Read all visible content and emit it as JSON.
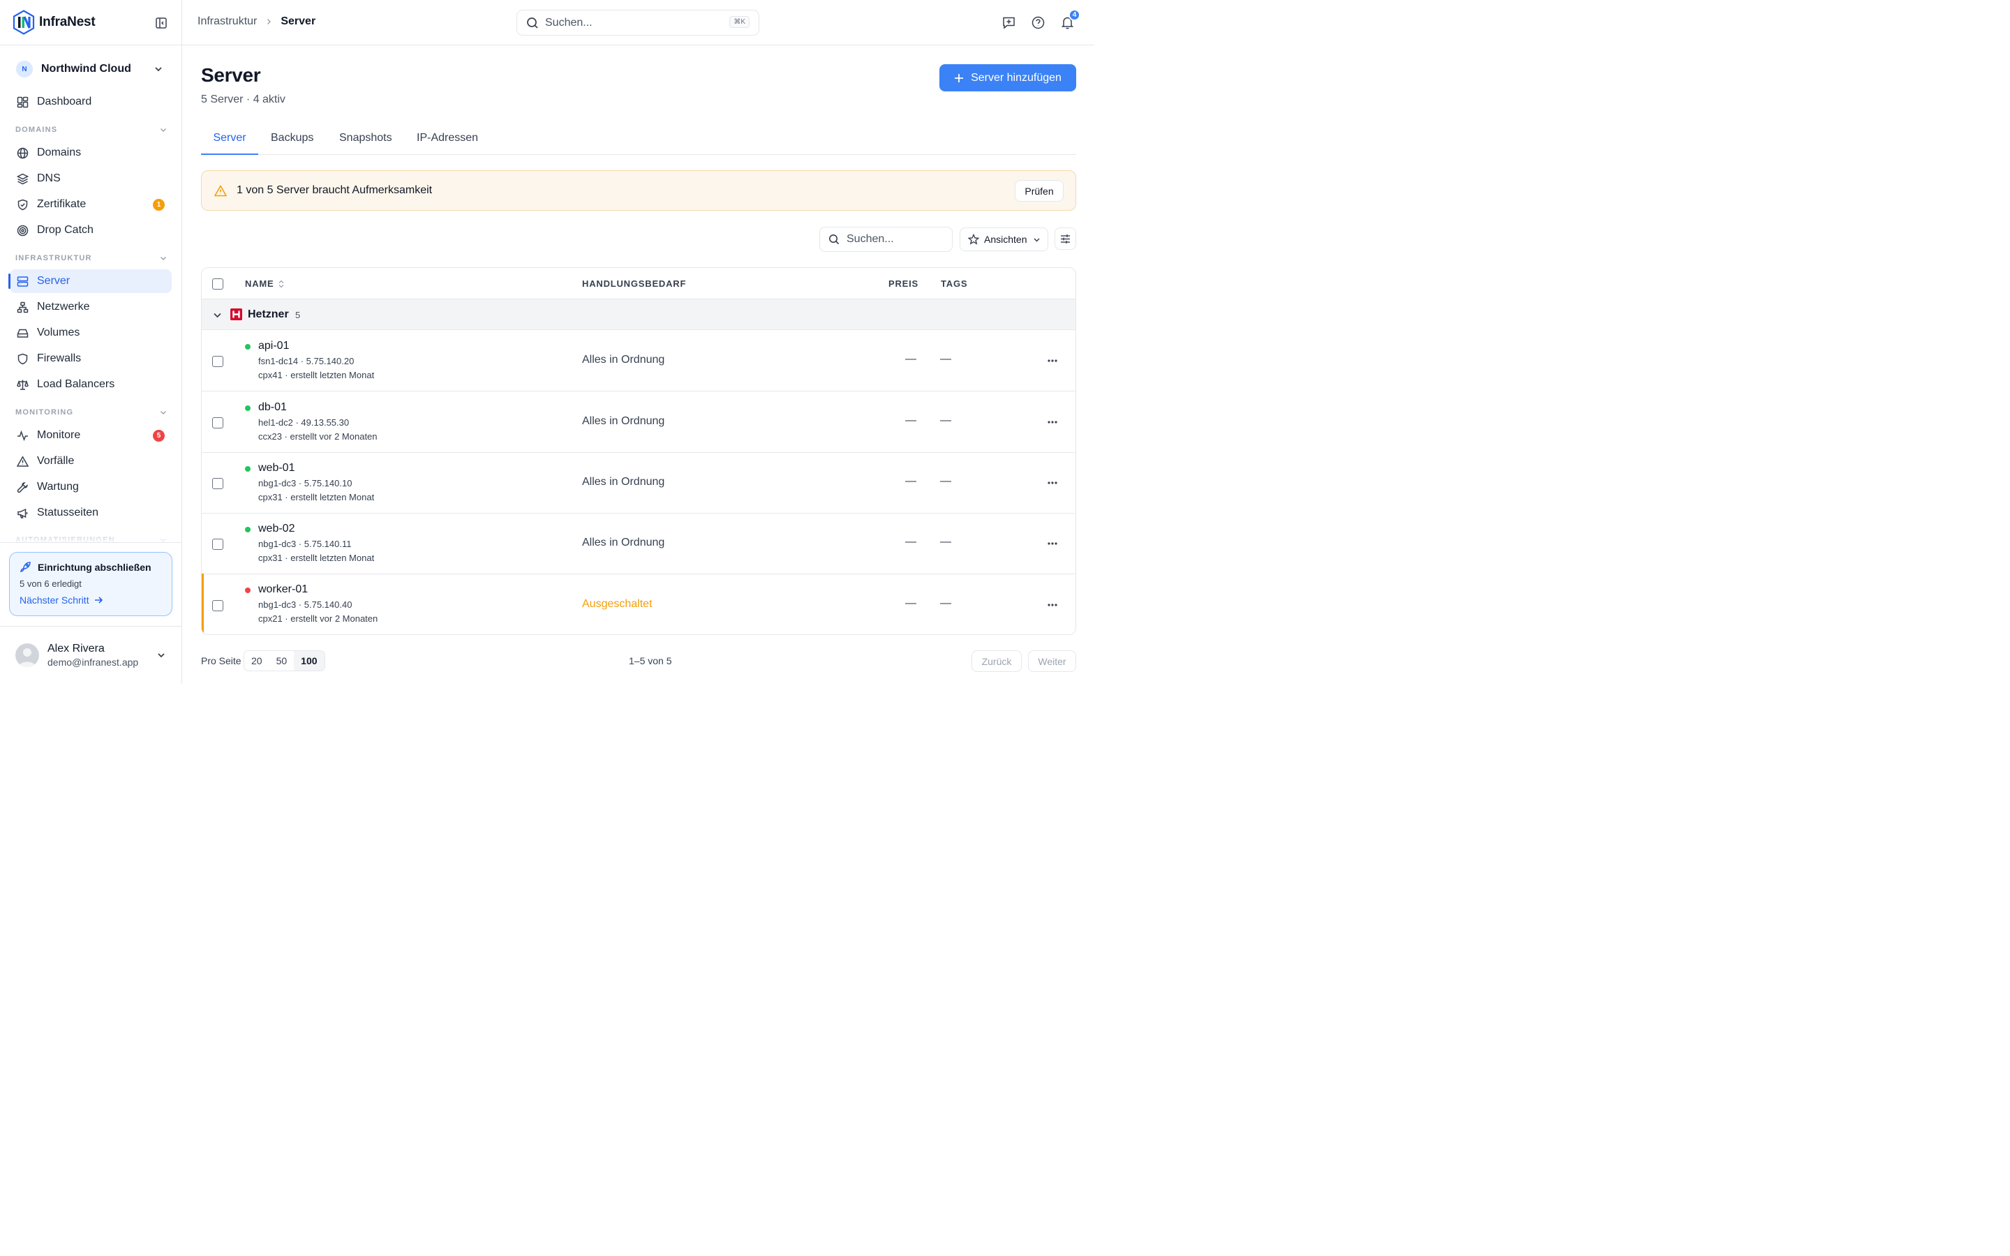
{
  "brand": {
    "name": "InfraNest"
  },
  "org": {
    "initial": "N",
    "name": "Northwind Cloud"
  },
  "nav": {
    "dashboard": "Dashboard",
    "sections": {
      "domains": "DOMAINS",
      "infrastruktur": "INFRASTRUKTUR",
      "monitoring": "MONITORING",
      "automatisierungen": "AUTOMATISIERUNGEN"
    },
    "domains_items": [
      "Domains",
      "DNS",
      "Zertifikate",
      "Drop Catch"
    ],
    "infra_items": [
      "Server",
      "Netzwerke",
      "Volumes",
      "Firewalls",
      "Load Balancers"
    ],
    "monitoring_items": [
      "Monitore",
      "Vorfälle",
      "Wartung",
      "Statusseiten"
    ],
    "badges": {
      "zertifikate": "1",
      "monitore": "5"
    }
  },
  "setup": {
    "title": "Einrichtung abschließen",
    "progress": "5 von 6 erledigt",
    "link": "Nächster Schritt"
  },
  "user": {
    "name": "Alex Rivera",
    "email": "demo@infranest.app"
  },
  "topbar": {
    "breadcrumb": [
      "Infrastruktur",
      "Server"
    ],
    "search_placeholder": "Suchen...",
    "shortcut": "⌘K",
    "notifications": "4"
  },
  "page": {
    "title": "Server",
    "subtitle": "5 Server · 4 aktiv",
    "add_button": "Server hinzufügen",
    "tabs": [
      "Server",
      "Backups",
      "Snapshots",
      "IP-Adressen"
    ],
    "active_tab": "Server"
  },
  "alert": {
    "text": "1 von 5 Server braucht Aufmerksamkeit",
    "button": "Prüfen"
  },
  "table": {
    "search_placeholder": "Suchen...",
    "views_label": "Ansichten",
    "columns": {
      "name": "NAME",
      "action": "HANDLUNGSBEDARF",
      "price": "PREIS",
      "tags": "TAGS"
    },
    "group": {
      "name": "Hetzner",
      "count": "5"
    },
    "rows": [
      {
        "name": "api-01",
        "location": "fsn1-dc14 · 5.75.140.20",
        "details": "cpx41 · erstellt letzten Monat",
        "status": "Alles in Ordnung",
        "price": "—",
        "tags": "—",
        "state": "running"
      },
      {
        "name": "db-01",
        "location": "hel1-dc2 · 49.13.55.30",
        "details": "ccx23 · erstellt vor 2 Monaten",
        "status": "Alles in Ordnung",
        "price": "—",
        "tags": "—",
        "state": "running"
      },
      {
        "name": "web-01",
        "location": "nbg1-dc3 · 5.75.140.10",
        "details": "cpx31 · erstellt letzten Monat",
        "status": "Alles in Ordnung",
        "price": "—",
        "tags": "—",
        "state": "running"
      },
      {
        "name": "web-02",
        "location": "nbg1-dc3 · 5.75.140.11",
        "details": "cpx31 · erstellt letzten Monat",
        "status": "Alles in Ordnung",
        "price": "—",
        "tags": "—",
        "state": "running"
      },
      {
        "name": "worker-01",
        "location": "nbg1-dc3 · 5.75.140.40",
        "details": "cpx21 · erstellt vor 2 Monaten",
        "status": "Ausgeschaltet",
        "price": "—",
        "tags": "—",
        "state": "off"
      }
    ]
  },
  "pagination": {
    "per_page_label": "Pro Seite",
    "options": [
      "20",
      "50",
      "100"
    ],
    "selected": "100",
    "range": "1–5 von 5",
    "prev": "Zurück",
    "next": "Weiter"
  },
  "colors": {
    "accent": "#3b82f6",
    "running": "#22c55e",
    "off": "#ef4444",
    "warning": "#f59e0b"
  }
}
